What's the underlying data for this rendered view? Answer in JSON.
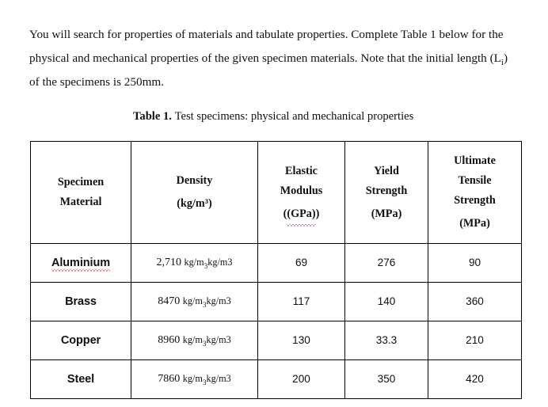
{
  "document": {
    "intro_paragraph": {
      "part1": "You will search for properties of materials and tabulate properties. Complete Table 1 below for the physical and mechanical properties of the given specimen materials. Note that the initial length (L",
      "subscript": "i",
      "part2": ") of the specimens is 250mm."
    },
    "table_caption": {
      "label": "Table 1.",
      "text": "Test specimens: physical and mechanical properties"
    }
  },
  "table": {
    "headers": [
      {
        "lines": [
          "Specimen",
          "Material"
        ],
        "unit": ""
      },
      {
        "lines": [
          "Density"
        ],
        "unit": "(kg/m³)"
      },
      {
        "lines": [
          "Elastic",
          "Modulus"
        ],
        "unit": "(GPa)",
        "unit_misspelled": true
      },
      {
        "lines": [
          "Yield",
          "Strength"
        ],
        "unit": "(MPa)"
      },
      {
        "lines": [
          "Ultimate",
          "Tensile",
          "Strength"
        ],
        "unit": "(MPa)"
      }
    ],
    "rows": [
      {
        "material": "Aluminium",
        "material_misspelled": true,
        "density_value": "2,710",
        "density_unit_a": "kg/m",
        "density_sub": "3",
        "density_unit_b": "kg/m3",
        "elastic_modulus": "69",
        "yield_strength": "276",
        "ultimate_tensile_strength": "90"
      },
      {
        "material": "Brass",
        "material_misspelled": false,
        "density_value": "8470",
        "density_unit_a": "kg/m",
        "density_sub": "3",
        "density_unit_b": "kg/m3",
        "elastic_modulus": "117",
        "yield_strength": "140",
        "ultimate_tensile_strength": "360"
      },
      {
        "material": "Copper",
        "material_misspelled": false,
        "density_value": "8960",
        "density_unit_a": "kg/m",
        "density_sub": "3",
        "density_unit_b": "kg/m3",
        "elastic_modulus": "130",
        "yield_strength": "33.3",
        "ultimate_tensile_strength": "210"
      },
      {
        "material": "Steel",
        "material_misspelled": false,
        "density_value": "7860",
        "density_unit_a": "kg/m",
        "density_sub": "3",
        "density_unit_b": "kg/m3",
        "elastic_modulus": "200",
        "yield_strength": "350",
        "ultimate_tensile_strength": "420"
      }
    ]
  },
  "colors": {
    "text": "#111111",
    "border": "#000000",
    "spellcheck_underline": "#cc3333",
    "background": "#ffffff"
  }
}
